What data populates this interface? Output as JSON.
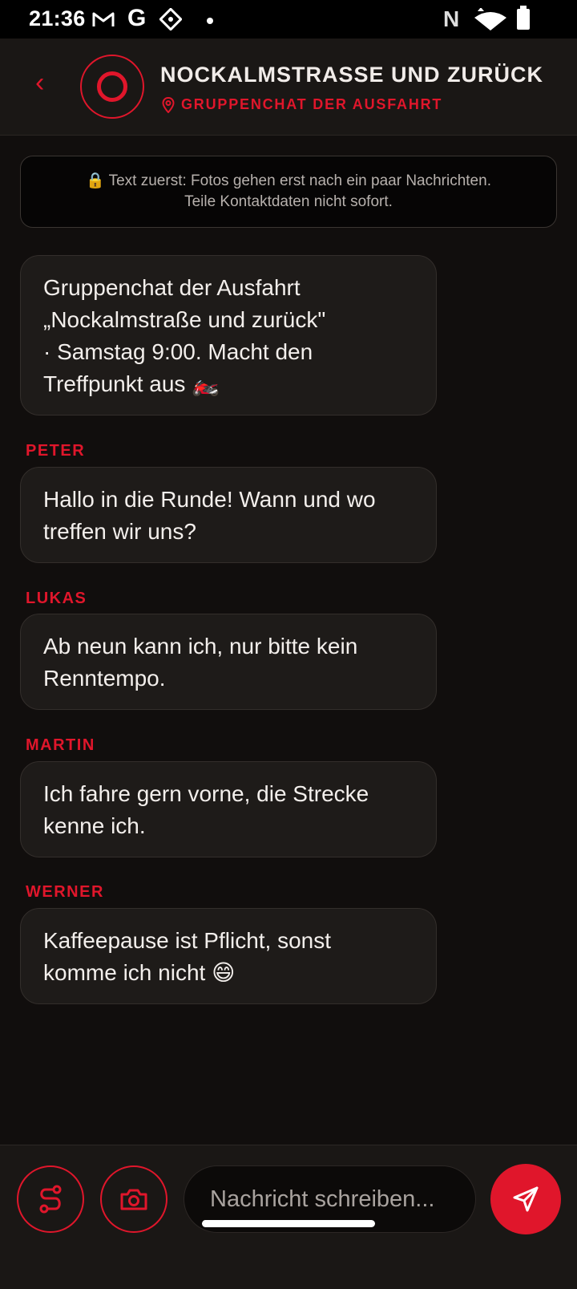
{
  "status_bar": {
    "time": "21:36",
    "icons": [
      "gmail-icon",
      "google-icon",
      "app-icon",
      "dot",
      "nfc-icon",
      "wifi-icon",
      "battery-icon"
    ]
  },
  "header": {
    "back_label": "‹",
    "title": "NOCKALMSTRASSE UND ZURÜCK",
    "subtitle": "GRUPPENCHAT DER AUSFAHRT",
    "accent_color": "#e0162b"
  },
  "notice": {
    "line1": "🔒 Text zuerst: Fotos gehen erst nach ein paar Nachrichten.",
    "line2": "Teile Kontaktdaten nicht sofort."
  },
  "messages": [
    {
      "sender": "",
      "lines": [
        "Gruppenchat der Ausfahrt",
        "„Nockalmstraße und zurück\"",
        "· Samstag 9:00. Macht den",
        "Treffpunkt aus 🏍️"
      ]
    },
    {
      "sender": "PETER",
      "lines": [
        "Hallo in die Runde! Wann und wo",
        "treffen wir uns?"
      ]
    },
    {
      "sender": "LUKAS",
      "lines": [
        "Ab neun kann ich, nur bitte kein",
        "Renntempo."
      ]
    },
    {
      "sender": "MARTIN",
      "lines": [
        "Ich fahre gern vorne, die Strecke",
        "kenne ich."
      ]
    },
    {
      "sender": "WERNER",
      "lines": [
        "Kaffeepause ist Pflicht, sonst",
        "komme ich nicht 😄"
      ]
    }
  ],
  "composer": {
    "placeholder": "Nachricht schreiben..."
  }
}
